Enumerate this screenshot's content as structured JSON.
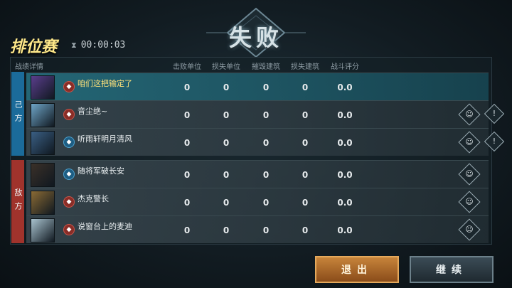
{
  "header": {
    "result_title": "失败",
    "mode_title": "排位赛",
    "timer": "00:00:03"
  },
  "columns": {
    "details": "战绩详情",
    "kills": "击败单位",
    "losses": "损失单位",
    "buildings_destroyed": "摧毁建筑",
    "buildings_lost": "损失建筑",
    "combat_score": "战斗评分"
  },
  "sides": {
    "ally_label": "己方",
    "enemy_label": "敌方"
  },
  "players": [
    {
      "name": "咱们这把输定了",
      "side": "ally",
      "self": true,
      "rank_color": "red",
      "avatar_color": "#5a3e8c",
      "kills": "0",
      "losses": "0",
      "built_destroyed": "0",
      "built_lost": "0",
      "score": "0.0",
      "show_profile": false,
      "show_report": false
    },
    {
      "name": "音尘绝~",
      "side": "ally",
      "self": false,
      "rank_color": "red",
      "avatar_color": "#6fa6c8",
      "kills": "0",
      "losses": "0",
      "built_destroyed": "0",
      "built_lost": "0",
      "score": "0.0",
      "show_profile": true,
      "show_report": true
    },
    {
      "name": "听雨轩明月清风",
      "side": "ally",
      "self": false,
      "rank_color": "blue",
      "avatar_color": "#3a5f84",
      "kills": "0",
      "losses": "0",
      "built_destroyed": "0",
      "built_lost": "0",
      "score": "0.0",
      "show_profile": true,
      "show_report": true
    },
    {
      "name": "随将军破长安",
      "side": "enemy",
      "self": false,
      "rank_color": "blue",
      "avatar_color": "#3a3028",
      "kills": "0",
      "losses": "0",
      "built_destroyed": "0",
      "built_lost": "0",
      "score": "0.0",
      "show_profile": true,
      "show_report": false
    },
    {
      "name": "杰克警长",
      "side": "enemy",
      "self": false,
      "rank_color": "red",
      "avatar_color": "#8a6a34",
      "kills": "0",
      "losses": "0",
      "built_destroyed": "0",
      "built_lost": "0",
      "score": "0.0",
      "show_profile": true,
      "show_report": false
    },
    {
      "name": "说窗台上的麦迪",
      "side": "enemy",
      "self": false,
      "rank_color": "red",
      "avatar_color": "#a9c3cf",
      "kills": "0",
      "losses": "0",
      "built_destroyed": "0",
      "built_lost": "0",
      "score": "0.0",
      "show_profile": true,
      "show_report": false
    }
  ],
  "icons": {
    "profile": "person-icon",
    "report": "exclamation-icon",
    "timer": "hourglass-icon"
  },
  "buttons": {
    "exit": "退出",
    "continue": "继续"
  }
}
